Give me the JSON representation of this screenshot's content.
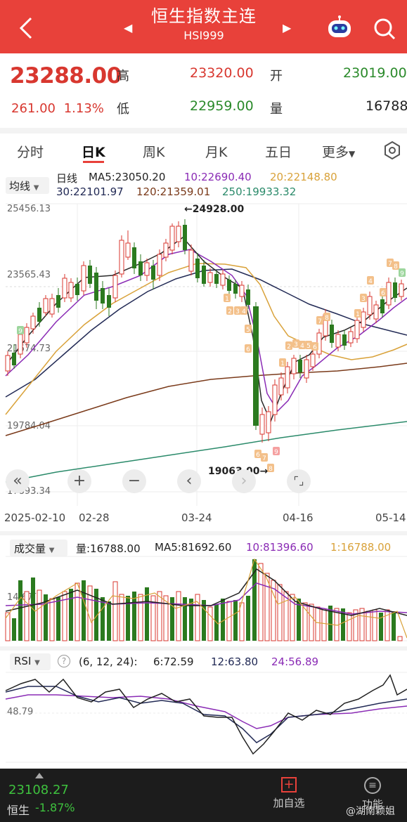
{
  "header": {
    "title": "恒生指数主连",
    "code": "HSI999",
    "bg_color": "#e8413a"
  },
  "quote": {
    "price": "23288.00",
    "change": "261.00",
    "change_pct": "1.13%",
    "high_label": "高",
    "high": "23320.00",
    "low_label": "低",
    "low": "22959.00",
    "open_label": "开",
    "open": "23019.00",
    "volume_label": "量",
    "volume": "16788"
  },
  "tabs": [
    "分时",
    "日K",
    "周K",
    "月K",
    "五日",
    "更多"
  ],
  "active_tab": "日K",
  "ma_legend": {
    "selector": "均线",
    "kind": "日线",
    "ma5": "MA5:23050.20",
    "ma10": "10:22690.40",
    "ma20": "20:22148.80",
    "ma30": "30:22101.97",
    "ma120": "120:21359.01",
    "ma250": "250:19933.32"
  },
  "chart_labels": {
    "max": "←24928.00",
    "min": "19063.00→"
  },
  "chart_data": {
    "type": "candlestick",
    "y_ticks": [
      "25456.13",
      "23565.43",
      "21674.73",
      "19784.04",
      "17893.34"
    ],
    "ylim": [
      17893.34,
      25456.13
    ],
    "x_ticks": [
      "2025-02-10",
      "02-28",
      "03-24",
      "04-16",
      "05-14"
    ],
    "high_marker": 24928.0,
    "low_marker": 19063.0,
    "ma_series": [
      {
        "name": "MA5",
        "value": 23050.2,
        "color": "#2a2a2a"
      },
      {
        "name": "10",
        "value": 22690.4,
        "color": "#8a2bb5"
      },
      {
        "name": "20",
        "value": 22148.8,
        "color": "#d9a23a"
      },
      {
        "name": "30",
        "value": 22101.97,
        "color": "#222a55"
      },
      {
        "name": "120",
        "value": 21359.01,
        "color": "#7a3a1a"
      },
      {
        "name": "250",
        "value": 19933.32,
        "color": "#2a8a6a"
      }
    ]
  },
  "volume": {
    "selector": "成交量",
    "vol": "量:16788.00",
    "ma5": "MA5:81692.60",
    "ma10": "10:81396.60",
    "ma1": "1:16788.00",
    "tick": "14.6万"
  },
  "rsi": {
    "selector": "RSI",
    "params": "(6, 12, 24):",
    "r6": "6:72.59",
    "r12": "12:63.80",
    "r24": "24:56.89",
    "tick": "48.79"
  },
  "bottom": {
    "index_value": "23108.27",
    "index_name": "恒生",
    "index_change": "-1.87%",
    "add_label": "加自选",
    "func_label": "功能",
    "watermark": "@湖南颖姐"
  }
}
